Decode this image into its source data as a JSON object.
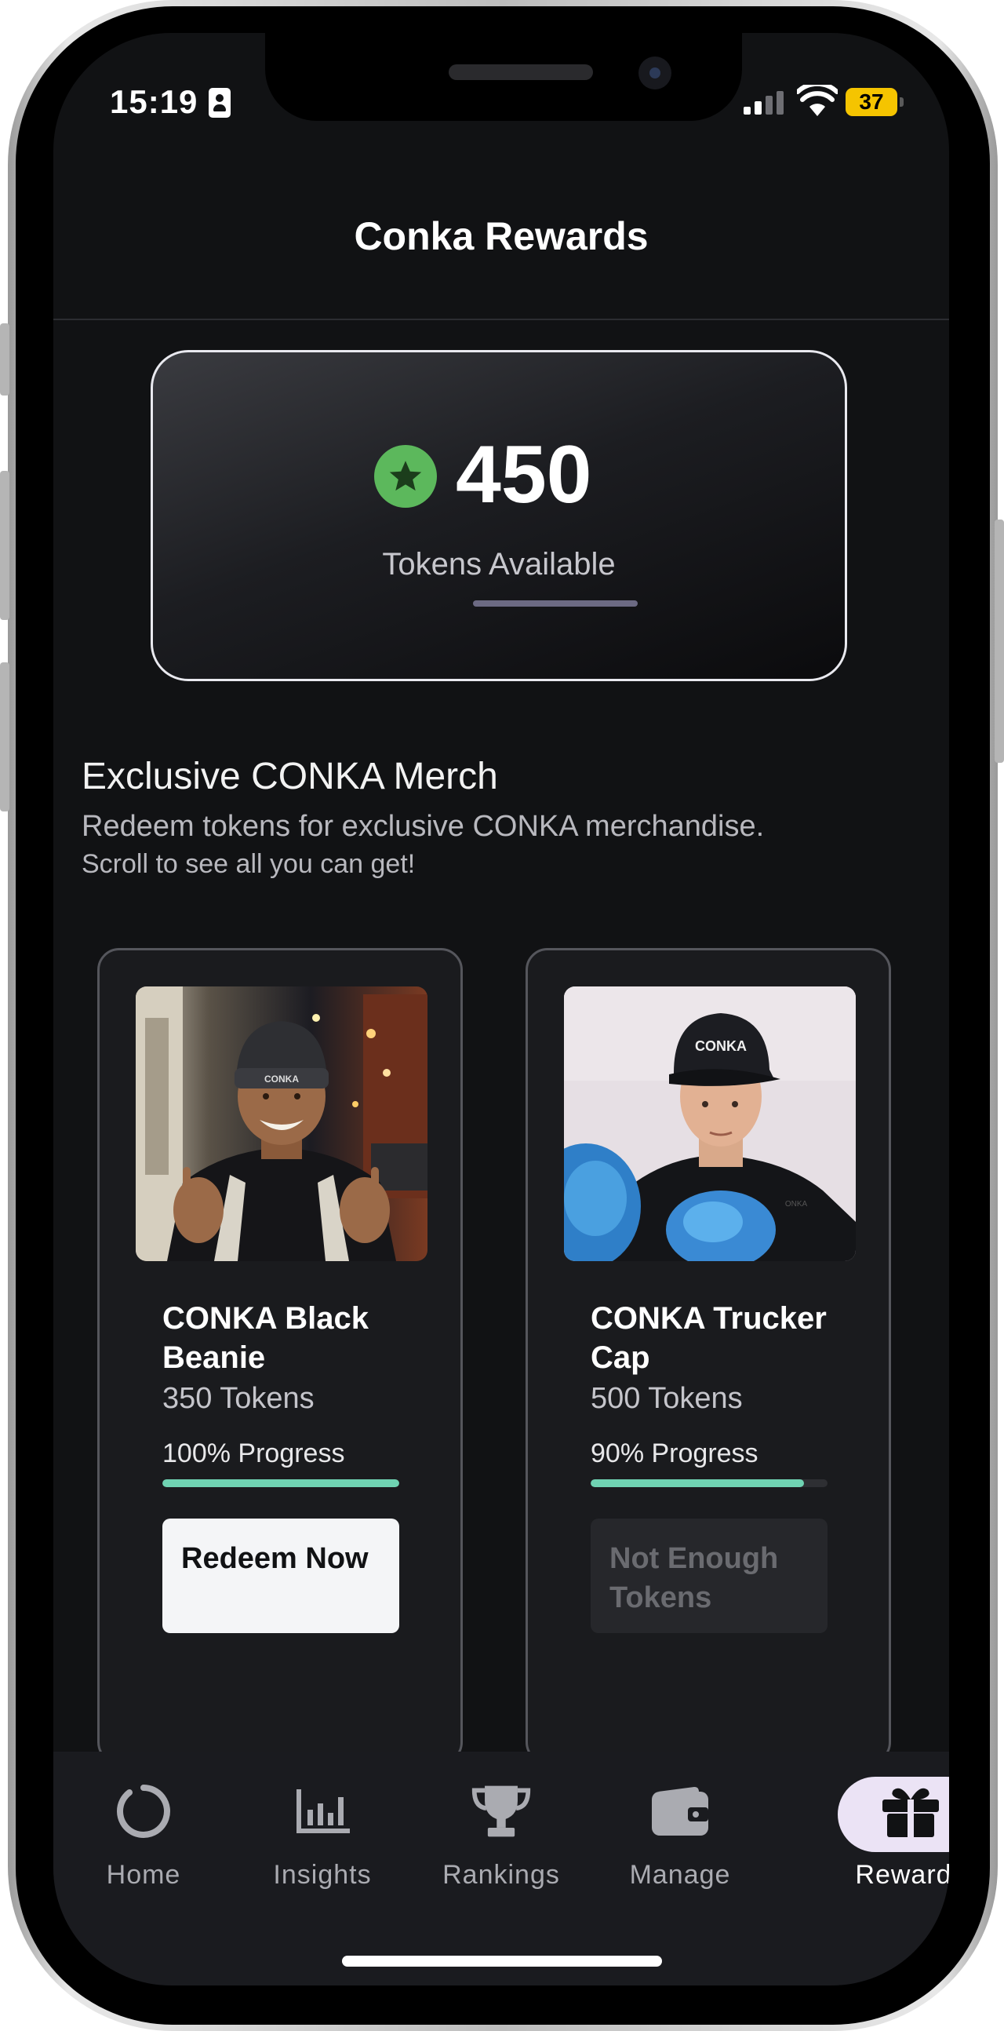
{
  "status_bar": {
    "time": "15:19",
    "battery": "37"
  },
  "header": {
    "title": "Conka Rewards"
  },
  "tokens": {
    "amount": "450",
    "label": "Tokens Available",
    "icon": "star-icon",
    "accent": "#5cb85c"
  },
  "merch_section": {
    "title": "Exclusive CONKA Merch",
    "description": "Redeem tokens for exclusive CONKA merchandise.",
    "hint": "Scroll to see all you can get!"
  },
  "merch_items": [
    {
      "name": "CONKA Black Beanie",
      "cost": "350 Tokens",
      "progress_label": "100% Progress",
      "progress": 1.0,
      "button": "Redeem Now",
      "button_enabled": true
    },
    {
      "name": "CONKA Trucker Cap",
      "cost": "500 Tokens",
      "progress_label": "90% Progress",
      "progress": 0.9,
      "button": "Not Enough Tokens",
      "button_enabled": false
    }
  ],
  "nav": {
    "items": [
      {
        "label": "Home",
        "icon": "home-ring-icon"
      },
      {
        "label": "Insights",
        "icon": "bar-chart-icon"
      },
      {
        "label": "Rankings",
        "icon": "trophy-icon"
      },
      {
        "label": "Manage",
        "icon": "wallet-icon"
      },
      {
        "label": "Rewards",
        "icon": "gift-icon",
        "active": true
      }
    ],
    "active_color": "#ebe3f5",
    "progress_color": "#6fd3b2"
  }
}
